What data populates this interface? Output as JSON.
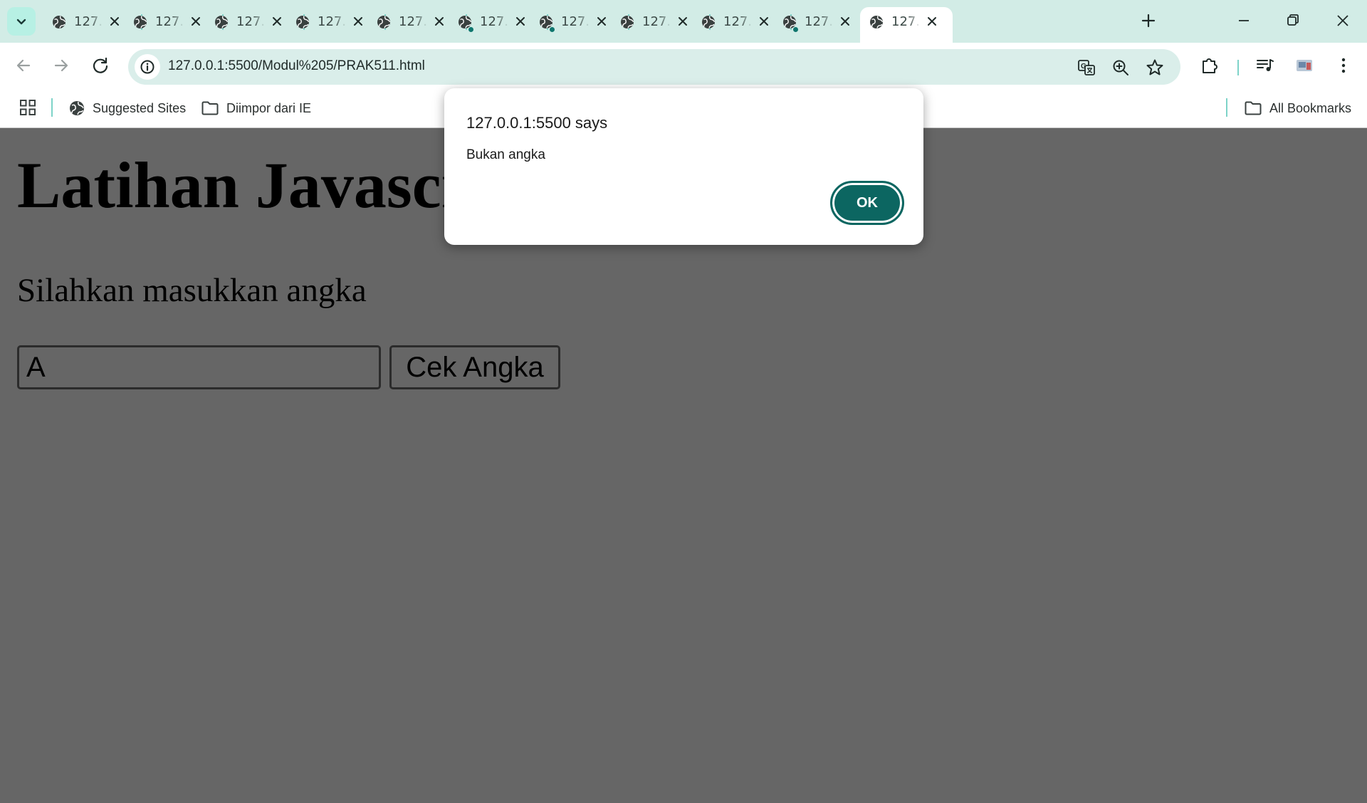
{
  "browser": {
    "tabs": [
      {
        "title": "127.",
        "has_dot": false,
        "active": false
      },
      {
        "title": "127.",
        "has_dot": false,
        "active": false
      },
      {
        "title": "127.",
        "has_dot": false,
        "active": false
      },
      {
        "title": "127.",
        "has_dot": false,
        "active": false
      },
      {
        "title": "127.",
        "has_dot": false,
        "active": false
      },
      {
        "title": "127.",
        "has_dot": true,
        "active": false
      },
      {
        "title": "127.",
        "has_dot": true,
        "active": false
      },
      {
        "title": "127.",
        "has_dot": false,
        "active": false
      },
      {
        "title": "127.",
        "has_dot": false,
        "active": false
      },
      {
        "title": "127.",
        "has_dot": true,
        "active": false
      },
      {
        "title": "127.",
        "has_dot": false,
        "active": true
      }
    ],
    "url": "127.0.0.1:5500/Modul%205/PRAK511.html",
    "bookmarks": {
      "suggested_sites": "Suggested Sites",
      "imported": "Diimpor dari IE",
      "all_bookmarks": "All Bookmarks"
    },
    "accent_color": "#0f766e",
    "frame_color": "#d2ece6"
  },
  "page": {
    "heading": "Latihan Javascript",
    "prompt": "Silahkan masukkan angka",
    "input_value": "A",
    "button_label": "Cek Angka"
  },
  "dialog": {
    "title": "127.0.0.1:5500 says",
    "message": "Bukan angka",
    "ok_label": "OK"
  }
}
